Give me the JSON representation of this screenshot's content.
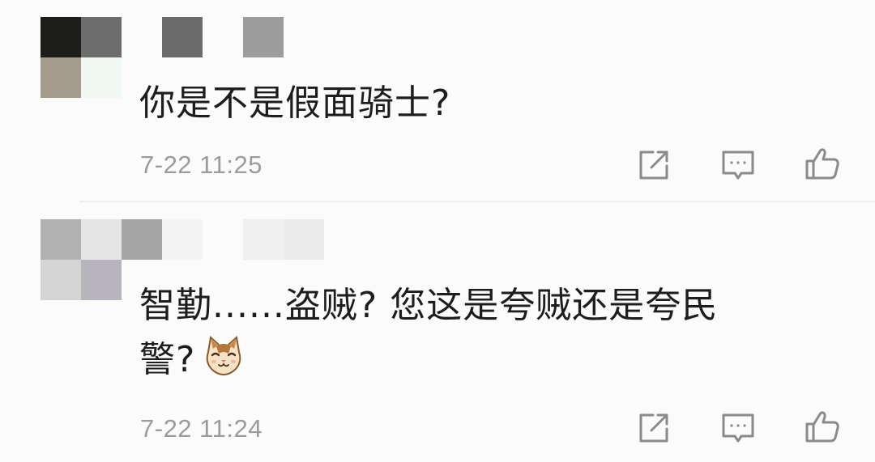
{
  "comments": [
    {
      "text": "你是不是假面骑士?",
      "time": "7-22 11:25",
      "avatar_colors": [
        "#1d1d1a",
        "#6d6d6d",
        "#a59c8e",
        "#f1f7f1"
      ],
      "name_colors": [
        "#6b6b6b",
        "#9c9c9c"
      ]
    },
    {
      "text_line1": "智勤......盗贼? 您这是夸贼还是夸民",
      "text_line2": "警?",
      "emoji": "cat-face-emoji",
      "time": "7-22 11:24",
      "avatar_colors": [
        "#b2b2b2",
        "#e5e5e5",
        "#d5d5d5",
        "#b7b5bb"
      ],
      "name_colors": [
        "#a5a5a5",
        "#f4f4f4",
        "#f0f0f0",
        "#ebebeb"
      ]
    }
  ],
  "icons": {
    "share": "share-icon",
    "reply": "reply-comment-icon",
    "like": "thumbs-up-icon"
  },
  "colors": {
    "background": "#fbfbfb",
    "text": "#1d1d1d",
    "timestamp": "#9b9b9b",
    "icon": "#8a8a8a",
    "divider": "#eeeeee"
  }
}
